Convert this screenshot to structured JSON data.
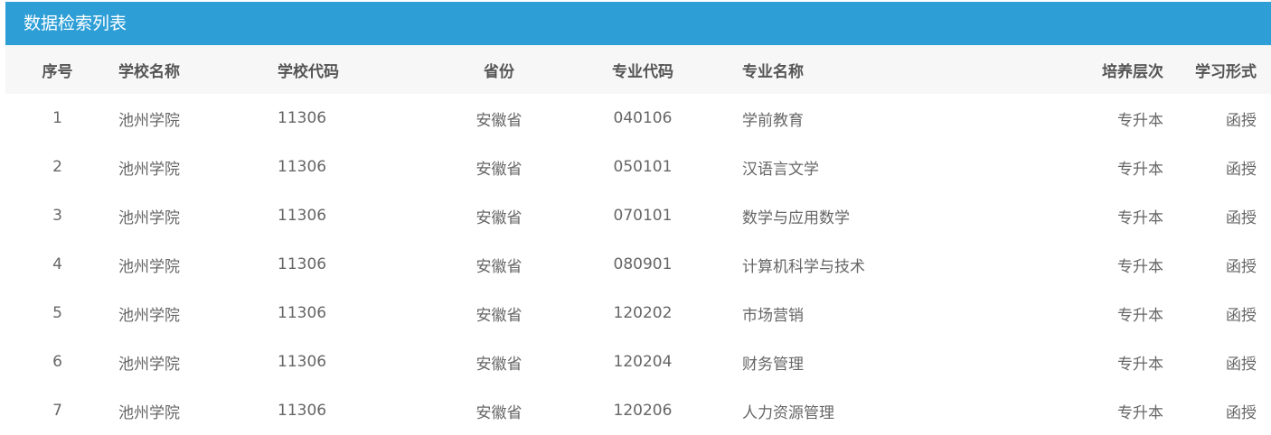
{
  "panel": {
    "title": "数据检索列表"
  },
  "table": {
    "headers": {
      "idx": "序号",
      "school": "学校名称",
      "school_code": "学校代码",
      "province": "省份",
      "major_code": "专业代码",
      "major_name": "专业名称",
      "level": "培养层次",
      "mode": "学习形式"
    },
    "rows": [
      {
        "idx": "1",
        "school": "池州学院",
        "school_code": "11306",
        "province": "安徽省",
        "major_code": "040106",
        "major_name": "学前教育",
        "level": "专升本",
        "mode": "函授"
      },
      {
        "idx": "2",
        "school": "池州学院",
        "school_code": "11306",
        "province": "安徽省",
        "major_code": "050101",
        "major_name": "汉语言文学",
        "level": "专升本",
        "mode": "函授"
      },
      {
        "idx": "3",
        "school": "池州学院",
        "school_code": "11306",
        "province": "安徽省",
        "major_code": "070101",
        "major_name": "数学与应用数学",
        "level": "专升本",
        "mode": "函授"
      },
      {
        "idx": "4",
        "school": "池州学院",
        "school_code": "11306",
        "province": "安徽省",
        "major_code": "080901",
        "major_name": "计算机科学与技术",
        "level": "专升本",
        "mode": "函授"
      },
      {
        "idx": "5",
        "school": "池州学院",
        "school_code": "11306",
        "province": "安徽省",
        "major_code": "120202",
        "major_name": "市场营销",
        "level": "专升本",
        "mode": "函授"
      },
      {
        "idx": "6",
        "school": "池州学院",
        "school_code": "11306",
        "province": "安徽省",
        "major_code": "120204",
        "major_name": "财务管理",
        "level": "专升本",
        "mode": "函授"
      },
      {
        "idx": "7",
        "school": "池州学院",
        "school_code": "11306",
        "province": "安徽省",
        "major_code": "120206",
        "major_name": "人力资源管理",
        "level": "专升本",
        "mode": "函授"
      }
    ]
  },
  "colors": {
    "header_bar": "#2e9fd6",
    "thead_bg": "#f7f7f7",
    "text": "#666666"
  }
}
